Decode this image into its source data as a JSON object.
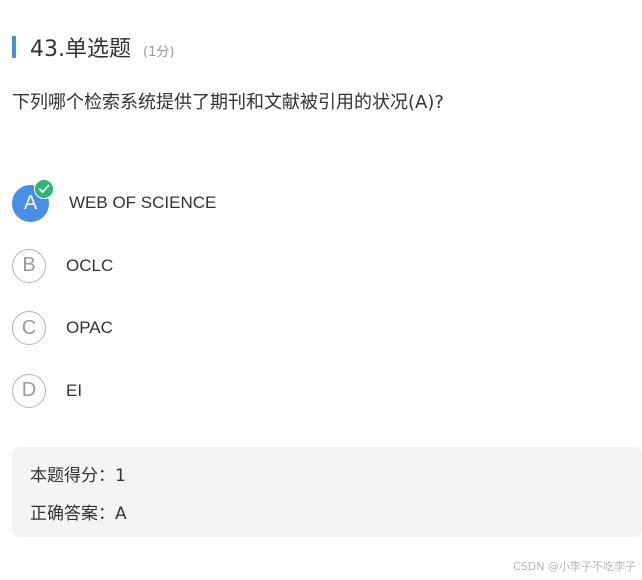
{
  "question": {
    "title": "43.单选题",
    "score": "(1分)",
    "text": "下列哪个检索系统提供了期刊和文献被引用的状况(A)?"
  },
  "options": [
    {
      "letter": "A",
      "text": "WEB OF SCIENCE",
      "selected": true
    },
    {
      "letter": "B",
      "text": "OCLC",
      "selected": false
    },
    {
      "letter": "C",
      "text": "OPAC",
      "selected": false
    },
    {
      "letter": "D",
      "text": "EI",
      "selected": false
    }
  ],
  "result": {
    "score_line": "本题得分：1",
    "answer_line": "正确答案：A"
  },
  "watermark": "CSDN @小李子不吃李子",
  "colors": {
    "accent": "#4a8fe7",
    "check": "#2bb673",
    "result_bg": "#f4f4f4"
  }
}
